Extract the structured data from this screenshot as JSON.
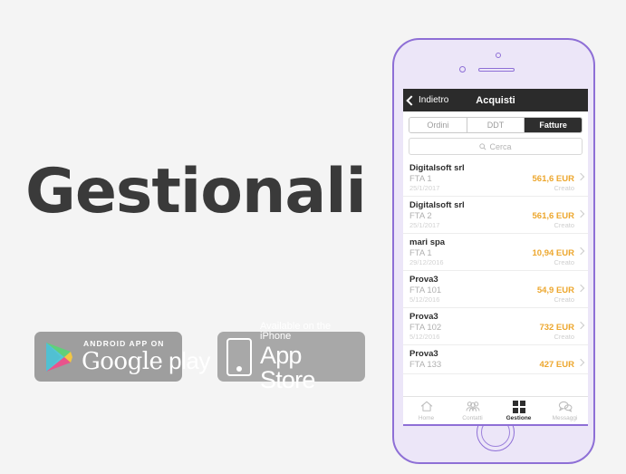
{
  "page": {
    "background": "#f4f4f4",
    "headline": "Gestionali"
  },
  "badges": {
    "google_play": {
      "supertext": "ANDROID APP ON",
      "main_left": "Google",
      "main_right": "play",
      "icon": "google-play-triangle-icon",
      "background": "#9e9e9e"
    },
    "app_store": {
      "supertext": "Available on the iPhone",
      "main": "App Store",
      "icon": "iphone-glyph-icon",
      "background": "#a8a8a8"
    }
  },
  "phone": {
    "frame_color": "#8e6fd6",
    "body_color": "#ece6f8",
    "camera": "camera-icon",
    "sensor": "proximity-sensor-icon",
    "speaker": "earpiece-speaker-icon",
    "home_button": "home-button-icon"
  },
  "app": {
    "navbar": {
      "back_label": "Indietro",
      "title": "Acquisti",
      "background": "#2b2b2b"
    },
    "segmented": {
      "options": [
        {
          "label": "Ordini",
          "active": false
        },
        {
          "label": "DDT",
          "active": false
        },
        {
          "label": "Fatture",
          "active": true
        }
      ]
    },
    "search": {
      "placeholder": "Cerca",
      "icon": "search-icon"
    },
    "accent_amount_color": "#eda72e",
    "list": [
      {
        "customer": "Digitalsoft srl",
        "document": "FTA 1",
        "amount": "561,6 EUR",
        "date": "25/1/2017",
        "status": "Creato"
      },
      {
        "customer": "Digitalsoft srl",
        "document": "FTA 2",
        "amount": "561,6 EUR",
        "date": "25/1/2017",
        "status": "Creato"
      },
      {
        "customer": "mari spa",
        "document": "FTA 1",
        "amount": "10,94 EUR",
        "date": "29/12/2016",
        "status": "Creato"
      },
      {
        "customer": "Prova3",
        "document": "FTA 101",
        "amount": "54,9 EUR",
        "date": "5/12/2016",
        "status": "Creato"
      },
      {
        "customer": "Prova3",
        "document": "FTA 102",
        "amount": "732 EUR",
        "date": "5/12/2016",
        "status": "Creato"
      },
      {
        "customer": "Prova3",
        "document": "FTA 133",
        "amount": "427 EUR",
        "date": "",
        "status": ""
      }
    ],
    "tabbar": {
      "tabs": [
        {
          "label": "Home",
          "icon": "house-icon",
          "active": false
        },
        {
          "label": "Contatti",
          "icon": "people-group-icon",
          "active": false
        },
        {
          "label": "Gestione",
          "icon": "grid-squares-icon",
          "active": true
        },
        {
          "label": "Messaggi",
          "icon": "chat-bubbles-icon",
          "active": false
        }
      ]
    }
  }
}
